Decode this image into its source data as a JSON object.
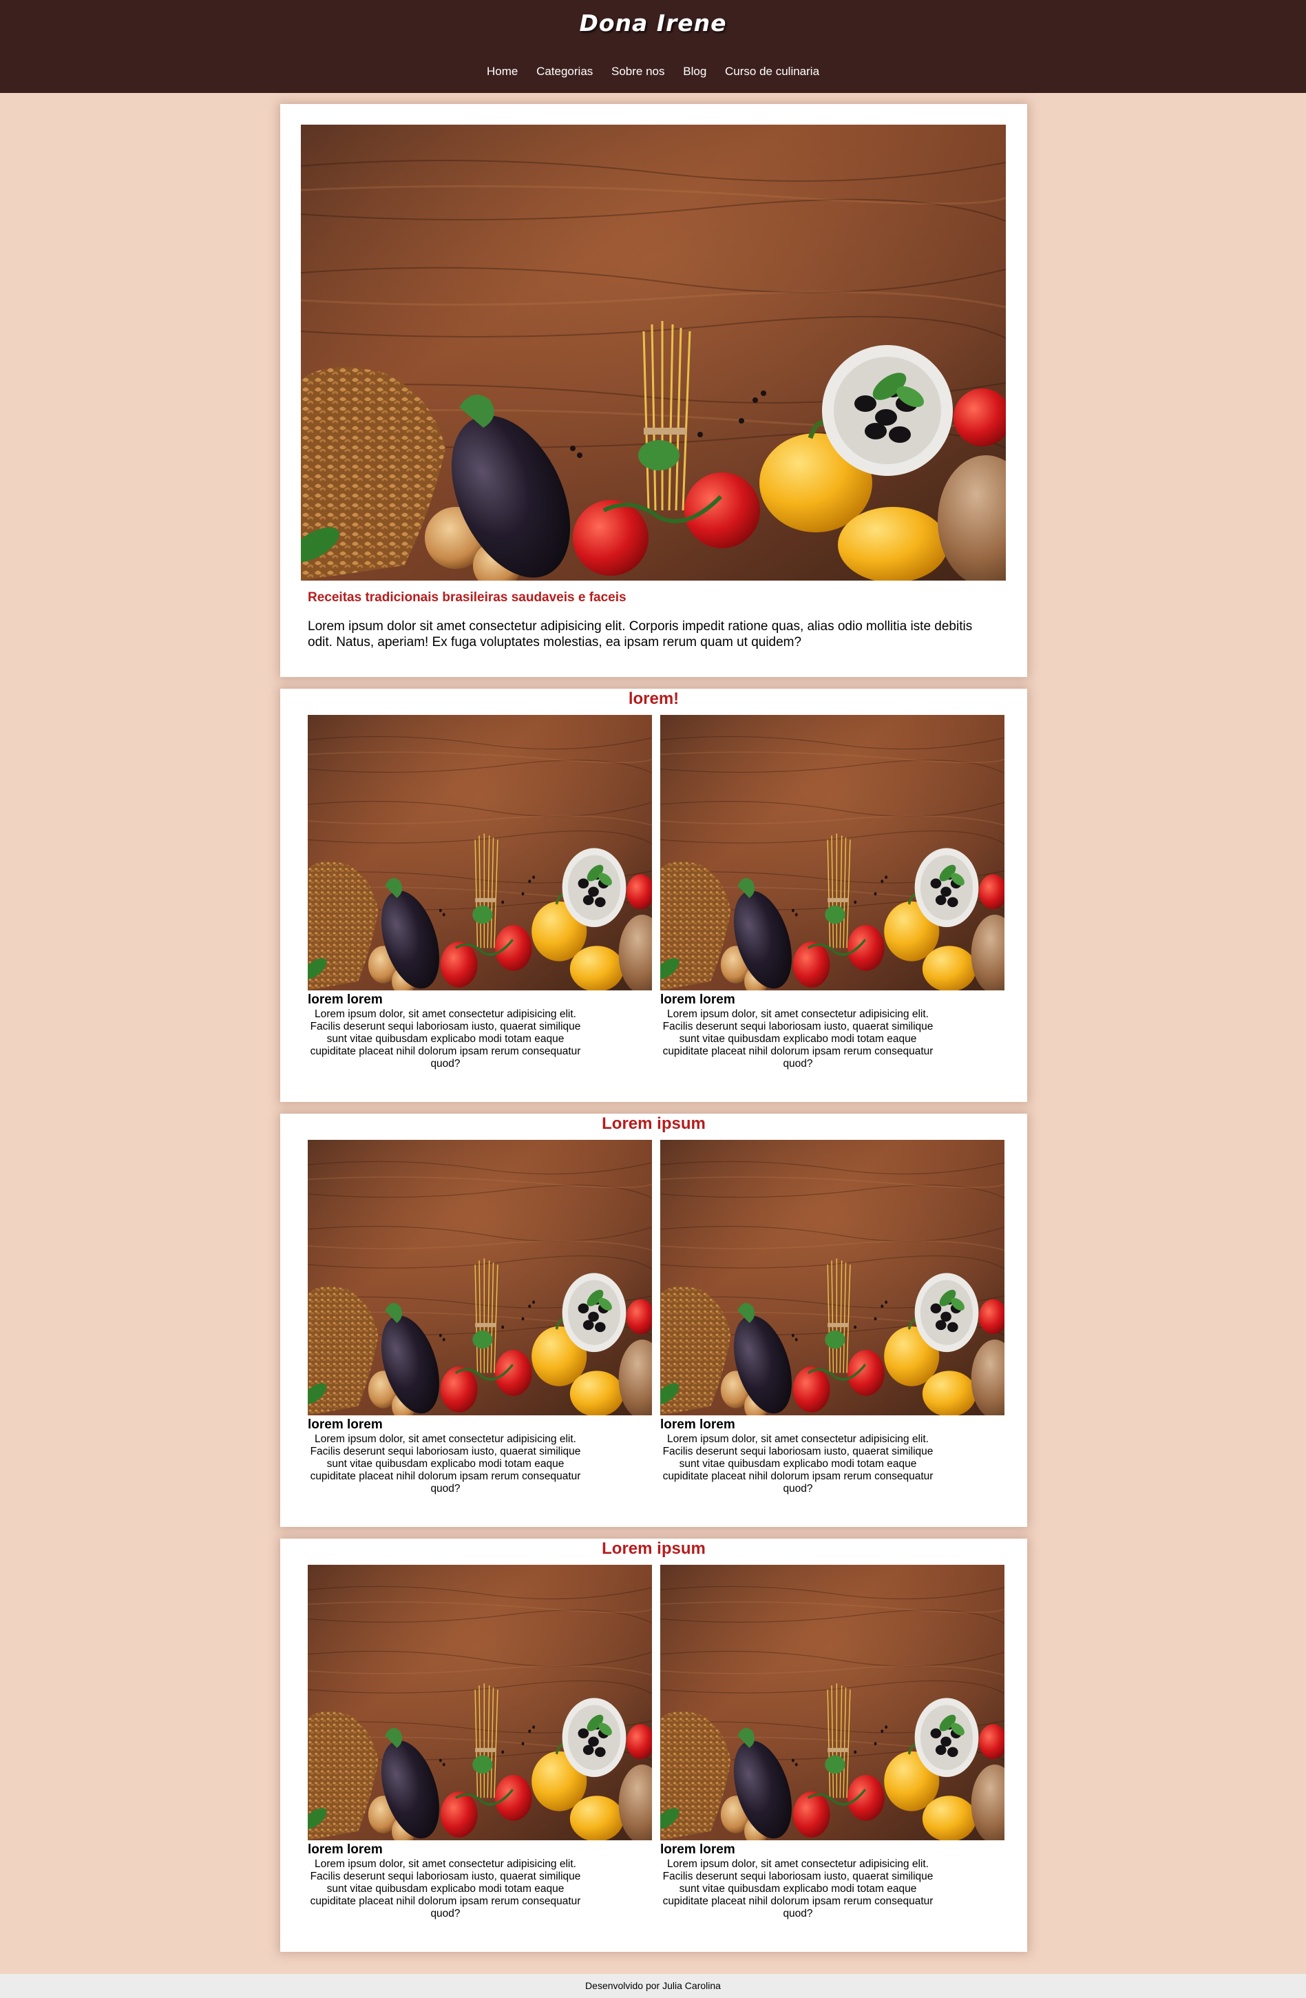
{
  "header": {
    "logo": "Dona Irene",
    "nav": [
      "Home",
      "Categorias",
      "Sobre nos",
      "Blog",
      "Curso de culinaria"
    ]
  },
  "hero": {
    "subtitle": "Receitas tradicionais brasileiras saudaveis e faceis",
    "text": "Lorem ipsum dolor sit amet consectetur adipisicing elit. Corporis impedit ratione quas, alias odio mollitia iste debitis odit. Natus, aperiam! Ex fuga voluptates molestias, ea ipsam rerum quam ut quidem?"
  },
  "sections": [
    {
      "title": "lorem!",
      "items": [
        {
          "title": "lorem lorem",
          "text": "Lorem ipsum dolor, sit amet consectetur adipisicing elit. Facilis deserunt sequi laboriosam iusto, quaerat similique sunt vitae quibusdam explicabo modi totam eaque cupiditate placeat nihil dolorum ipsam rerum consequatur quod?"
        },
        {
          "title": "lorem lorem",
          "text": "Lorem ipsum dolor, sit amet consectetur adipisicing elit. Facilis deserunt sequi laboriosam iusto, quaerat similique sunt vitae quibusdam explicabo modi totam eaque cupiditate placeat nihil dolorum ipsam rerum consequatur quod?"
        }
      ]
    },
    {
      "title": "Lorem ipsum",
      "items": [
        {
          "title": "lorem lorem",
          "text": "Lorem ipsum dolor, sit amet consectetur adipisicing elit. Facilis deserunt sequi laboriosam iusto, quaerat similique sunt vitae quibusdam explicabo modi totam eaque cupiditate placeat nihil dolorum ipsam rerum consequatur quod?"
        },
        {
          "title": "lorem lorem",
          "text": "Lorem ipsum dolor, sit amet consectetur adipisicing elit. Facilis deserunt sequi laboriosam iusto, quaerat similique sunt vitae quibusdam explicabo modi totam eaque cupiditate placeat nihil dolorum ipsam rerum consequatur quod?"
        }
      ]
    },
    {
      "title": "Lorem ipsum",
      "items": [
        {
          "title": "lorem lorem",
          "text": "Lorem ipsum dolor, sit amet consectetur adipisicing elit. Facilis deserunt sequi laboriosam iusto, quaerat similique sunt vitae quibusdam explicabo modi totam eaque cupiditate placeat nihil dolorum ipsam rerum consequatur quod?"
        },
        {
          "title": "lorem lorem",
          "text": "Lorem ipsum dolor, sit amet consectetur adipisicing elit. Facilis deserunt sequi laboriosam iusto, quaerat similique sunt vitae quibusdam explicabo modi totam eaque cupiditate placeat nihil dolorum ipsam rerum consequatur quod?"
        }
      ]
    }
  ],
  "footer": {
    "text": "Desenvolvido por Julia Carolina"
  },
  "colors": {
    "page_background": "#f1d3c2",
    "header_background": "#3c201e",
    "accent_red": "#b71c1c",
    "card_background": "#ffffff",
    "footer_background": "#ececec"
  },
  "images": {
    "food_photo": "food-ingredients-on-wooden-table"
  }
}
